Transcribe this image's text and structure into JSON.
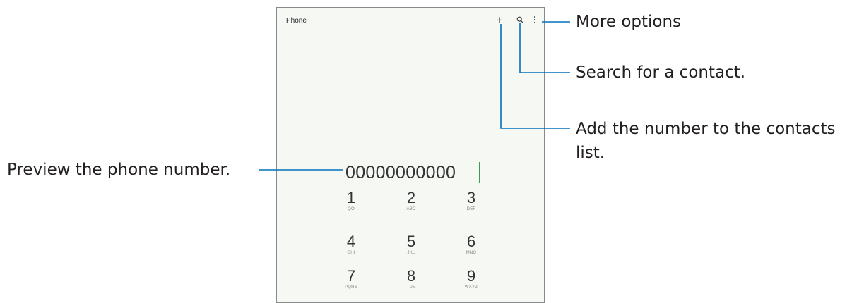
{
  "app": {
    "title": "Phone"
  },
  "toolbar": {
    "add_icon": "+",
    "icons": [
      "add-icon",
      "search-icon",
      "more-options-icon"
    ]
  },
  "dialer": {
    "number": "00000000000",
    "keys": [
      {
        "digit": "1",
        "letters": "QO"
      },
      {
        "digit": "2",
        "letters": "ABC"
      },
      {
        "digit": "3",
        "letters": "DEF"
      },
      {
        "digit": "4",
        "letters": "GHI"
      },
      {
        "digit": "5",
        "letters": "JKL"
      },
      {
        "digit": "6",
        "letters": "MNO"
      },
      {
        "digit": "7",
        "letters": "PQRS"
      },
      {
        "digit": "8",
        "letters": "TUV"
      },
      {
        "digit": "9",
        "letters": "WXYZ"
      }
    ]
  },
  "callouts": {
    "more_options": "More options",
    "search": "Search for a contact.",
    "add_number_line1": "Add the number to the contacts",
    "add_number_line2": "list.",
    "preview_number": "Preview the phone number."
  },
  "colors": {
    "callout_line": "#0072bc",
    "cursor": "#3c9a52",
    "screen_background": "#f6f8f4"
  }
}
